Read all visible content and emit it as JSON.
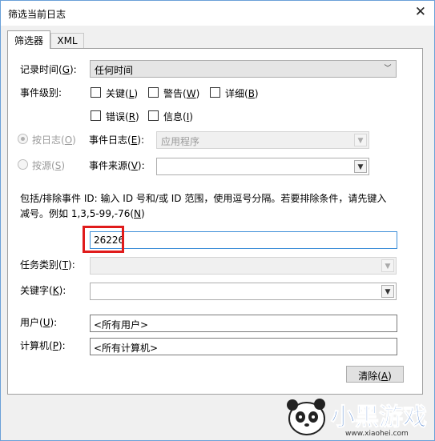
{
  "window": {
    "title": "筛选当前日志",
    "close_glyph": "✕"
  },
  "tabs": [
    {
      "label": "筛选器"
    },
    {
      "label": "XML"
    }
  ],
  "filter": {
    "logged": {
      "label": "记录时间(",
      "key": "G",
      "suffix": "):",
      "value": "任何时间"
    },
    "event_level": {
      "label": "事件级别:",
      "critical": {
        "label": "关键(",
        "key": "L",
        "suffix": ")"
      },
      "warning": {
        "label": "警告(",
        "key": "W",
        "suffix": ")"
      },
      "verbose": {
        "label": "详细(",
        "key": "B",
        "suffix": ")"
      },
      "error": {
        "label": "错误(",
        "key": "R",
        "suffix": ")"
      },
      "information": {
        "label": "信息(",
        "key": "I",
        "suffix": ")"
      }
    },
    "by_log": {
      "label": "按日志(",
      "key": "O",
      "suffix": ")"
    },
    "by_source": {
      "label": "按源(",
      "key": "S",
      "suffix": ")"
    },
    "event_logs": {
      "label": "事件日志(",
      "key": "E",
      "suffix": "):",
      "value": "应用程序"
    },
    "event_sources": {
      "label": "事件来源(",
      "key": "V",
      "suffix": "):",
      "value": ""
    },
    "event_ids": {
      "desc_line1": "包括/排除事件 ID: 输入 ID 号和/或 ID 范围，使用逗号分隔。若要排除条件，请先键入",
      "desc_line2_prefix": "减号。例如 1,3,5-99,-76(",
      "key": "N",
      "suffix": ")",
      "value": "26226"
    },
    "task_category": {
      "label": "任务类别(",
      "key": "T",
      "suffix": "):",
      "value": ""
    },
    "keywords": {
      "label": "关键字(",
      "key": "K",
      "suffix": "):",
      "value": ""
    },
    "user": {
      "label": "用户(",
      "key": "U",
      "suffix": "):",
      "value": "<所有用户>"
    },
    "computer": {
      "label": "计算机(",
      "key": "P",
      "suffix": "):",
      "value": "<所有计算机>"
    },
    "clear_button": {
      "label": "清除(",
      "key": "A",
      "suffix": ")"
    }
  },
  "watermark": {
    "brand": "小黑游戏",
    "url": "www.xiaohei.com"
  },
  "colors": {
    "highlight": "#e01b1b",
    "focus_border": "#3f8fd8",
    "brand_blue": "#1e5fc4"
  }
}
